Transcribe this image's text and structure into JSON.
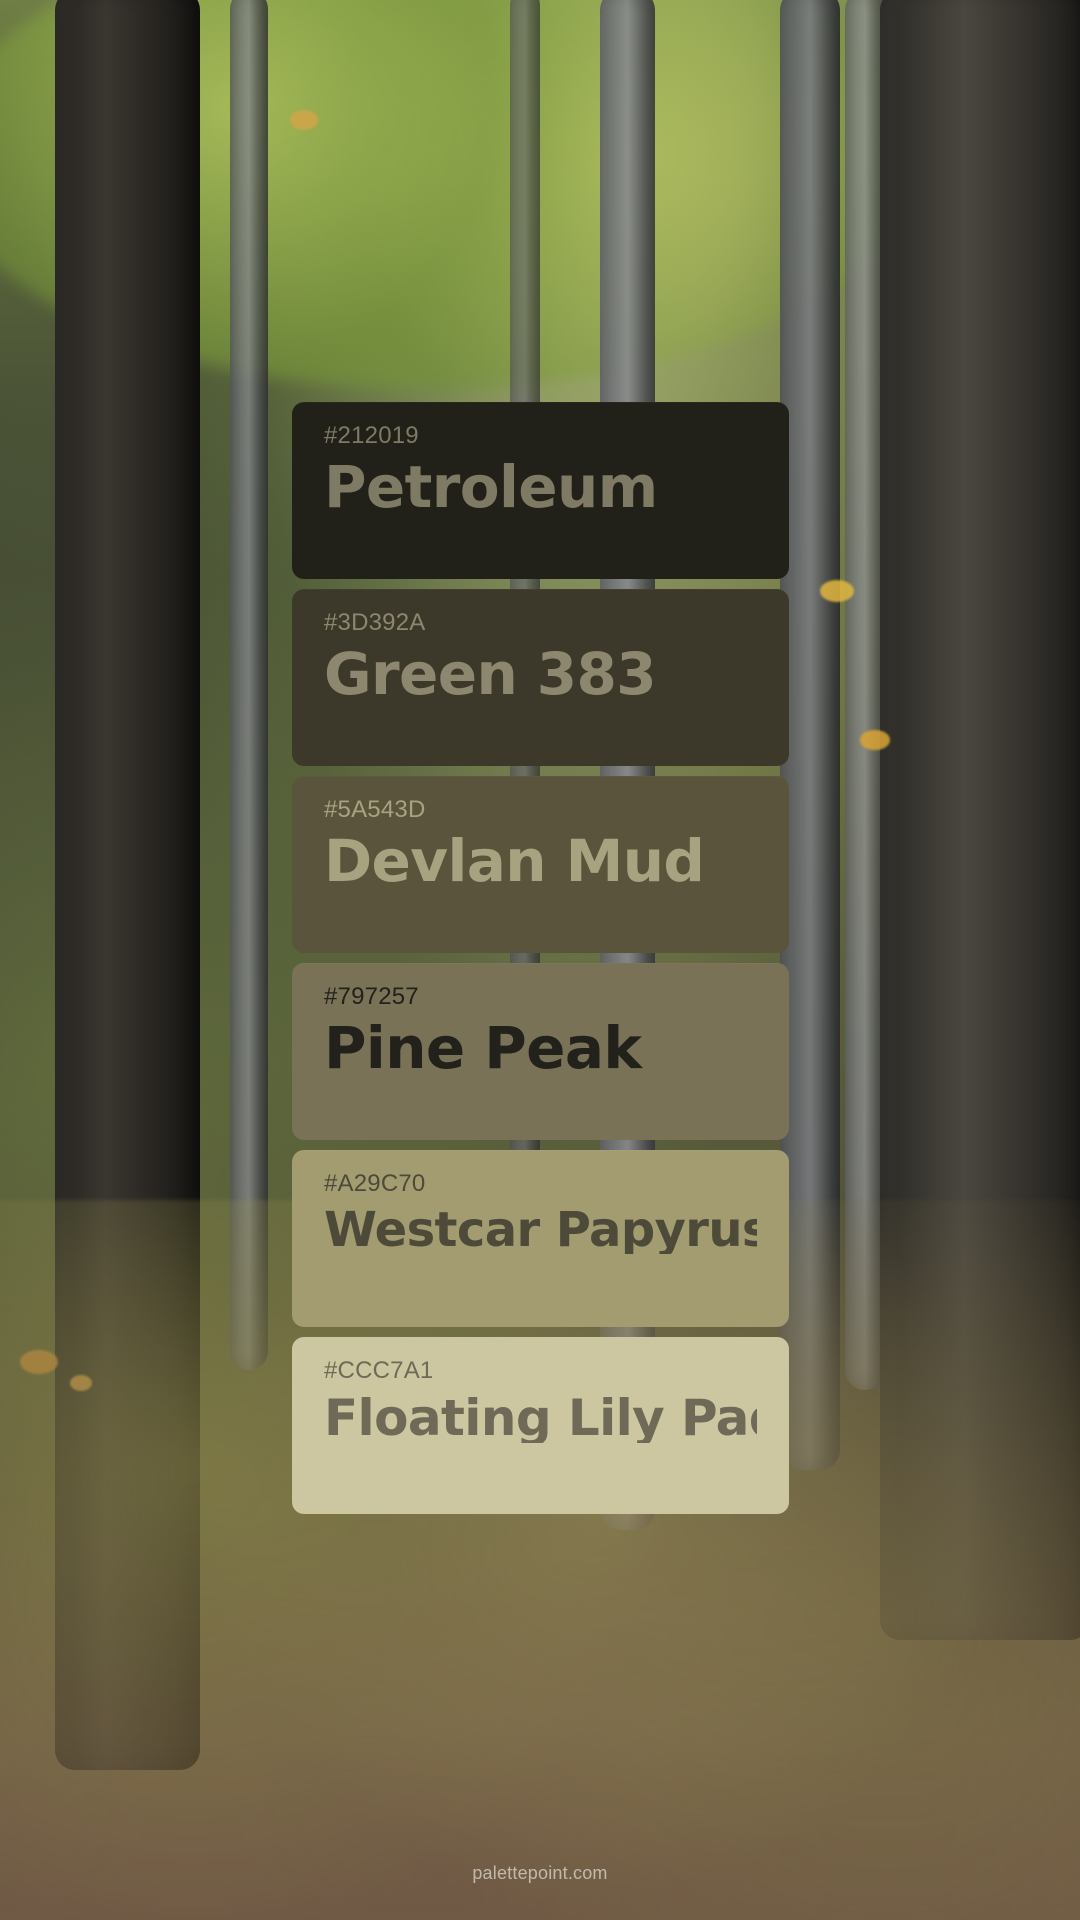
{
  "palette": {
    "items": [
      {
        "hex": "#212019",
        "name": "Petroleum",
        "swatch_color": "#212019",
        "text_color": "#7f7a64"
      },
      {
        "hex": "#3D392A",
        "name": "Green 383",
        "swatch_color": "#3D392A",
        "text_color": "#8d876f"
      },
      {
        "hex": "#5A543D",
        "name": "Devlan Mud",
        "swatch_color": "#5A543D",
        "text_color": "#a7a27f"
      },
      {
        "hex": "#797257",
        "name": "Pine Peak",
        "swatch_color": "#797257",
        "text_color": "#22211b"
      },
      {
        "hex": "#A29C70",
        "name": "Westcar Papyrus",
        "swatch_color": "#A29C70",
        "text_color": "#4e4a39"
      },
      {
        "hex": "#CCC7A1",
        "name": "Floating Lily Pad",
        "swatch_color": "#CCC7A1",
        "text_color": "#6e6a57"
      }
    ]
  },
  "watermark": {
    "text": "palettepoint.com"
  }
}
